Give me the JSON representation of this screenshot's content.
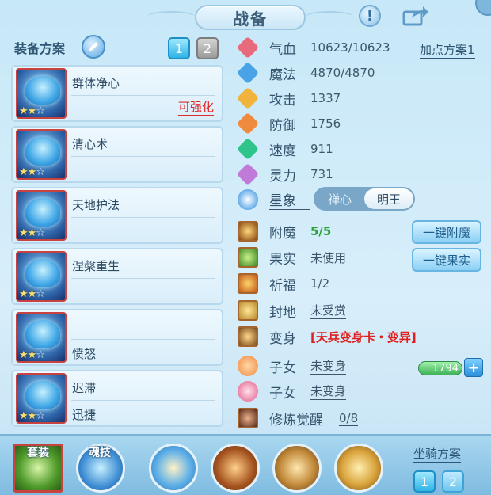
{
  "window": {
    "title": "战备"
  },
  "left": {
    "heading": "装备方案",
    "plan_buttons": [
      "1",
      "2"
    ],
    "skills": [
      {
        "name": "群体净心",
        "second": "",
        "badge": "可强化",
        "stars": "★★☆"
      },
      {
        "name": "清心术",
        "second": "",
        "badge": "",
        "stars": "★★☆"
      },
      {
        "name": "天地护法",
        "second": "",
        "badge": "",
        "stars": "★★☆"
      },
      {
        "name": "涅槃重生",
        "second": "",
        "badge": "",
        "stars": "★★☆"
      },
      {
        "name": "",
        "second": "愤怒",
        "badge": "",
        "stars": "★★☆"
      },
      {
        "name": "迟滞",
        "second": "迅捷",
        "badge": "",
        "stars": "★★☆"
      }
    ]
  },
  "stats": {
    "add_point_plan": "加点方案1",
    "items": [
      {
        "label": "气血",
        "value": "10623/10623",
        "color": "#e86a7d"
      },
      {
        "label": "魔法",
        "value": "4870/4870",
        "color": "#4aa3e6"
      },
      {
        "label": "攻击",
        "value": "1337",
        "color": "#f0b43c"
      },
      {
        "label": "防御",
        "value": "1756",
        "color": "#f08a3c"
      },
      {
        "label": "速度",
        "value": "911",
        "color": "#2fc48a"
      },
      {
        "label": "灵力",
        "value": "731",
        "color": "#c07ad8"
      }
    ],
    "star_sign": {
      "label": "星象",
      "options": [
        "禅心",
        "明王"
      ],
      "selected": "明王"
    },
    "enchant": {
      "label": "附魔",
      "value": "5/5",
      "button": "一键附魔"
    },
    "fruit": {
      "label": "果实",
      "value": "未使用",
      "button": "一键果实"
    },
    "blessing": {
      "label": "祈福",
      "value": "1/2"
    },
    "fief": {
      "label": "封地",
      "value": "未受赏"
    },
    "transform": {
      "label": "变身",
      "value": "[天兵变身卡・变异]"
    },
    "child1": {
      "label": "子女",
      "value": "未变身",
      "bar_value": "1794"
    },
    "child2": {
      "label": "子女",
      "value": "未变身"
    },
    "cultivation": {
      "label": "修炼觉醒",
      "value": "0/8"
    }
  },
  "bottom": {
    "set_label": "套装",
    "soul_label": "魂技",
    "mount_plan": "坐骑方案",
    "mount_buttons": [
      "1",
      "2"
    ]
  }
}
